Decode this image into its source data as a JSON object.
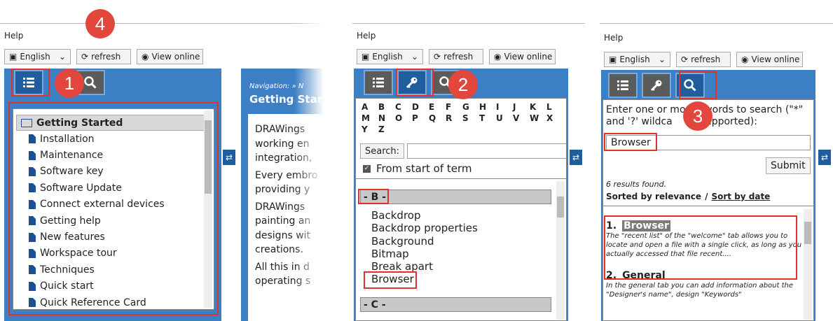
{
  "common": {
    "menu_help": "Help",
    "lang_select": "English",
    "refresh_label": "refresh",
    "view_online_label": "View online"
  },
  "badges": [
    "1",
    "2",
    "3",
    "4"
  ],
  "panel1": {
    "toc_header": "Getting Started",
    "toc_items": [
      "Installation",
      "Maintenance",
      "Software key",
      "Software Update",
      "Connect external devices",
      "Getting help",
      "New features",
      "Workspace tour",
      "Techniques",
      "Quick start",
      "Quick Reference Card"
    ],
    "nav_crumb": "Navigation: » N",
    "content_title": "Getting Star",
    "content_lines": [
      "DRAWings",
      "working en",
      "integration,",
      "Every embro",
      "providing y",
      "DRAWings",
      "painting an",
      "designs wit",
      "creations.",
      "All this in d",
      "operating s"
    ]
  },
  "panel2": {
    "letters": [
      "A",
      "B",
      "C",
      "D",
      "E",
      "F",
      "G",
      "H",
      "I",
      "J",
      "K",
      "L",
      "M",
      "N",
      "O",
      "P",
      "Q",
      "R",
      "S",
      "T",
      "U",
      "V",
      "W",
      "X",
      "Y",
      "Z"
    ],
    "search_button": "Search:",
    "search_value": "",
    "from_start_label": "From start of term",
    "section_b": "- B -",
    "keywords": [
      "Backdrop",
      "Backdrop properties",
      "Background",
      "Bitmap",
      "Break apart",
      "Browser"
    ],
    "section_c": "- C -"
  },
  "panel3": {
    "instructions": "Enter one or mo      words to search (\"*\" and '?' wildca      e supported):",
    "search_value": "Browser",
    "submit_label": "Submit",
    "results_found": "6 results found.",
    "sorted_by": "Sorted by relevance",
    "separator": "/",
    "sort_by_date": "Sort by date",
    "results": [
      {
        "num": "1.",
        "title": "Browser",
        "snippet": "The \"recent list\" of the \"welcome\" tab allows you to locate and open a file with a single click, as long as you actually accessed that file recent...."
      },
      {
        "num": "2.",
        "title": "General",
        "snippet": "In the general tab you can add information about the \"Designer's name\", design \"Keywords\""
      }
    ]
  }
}
